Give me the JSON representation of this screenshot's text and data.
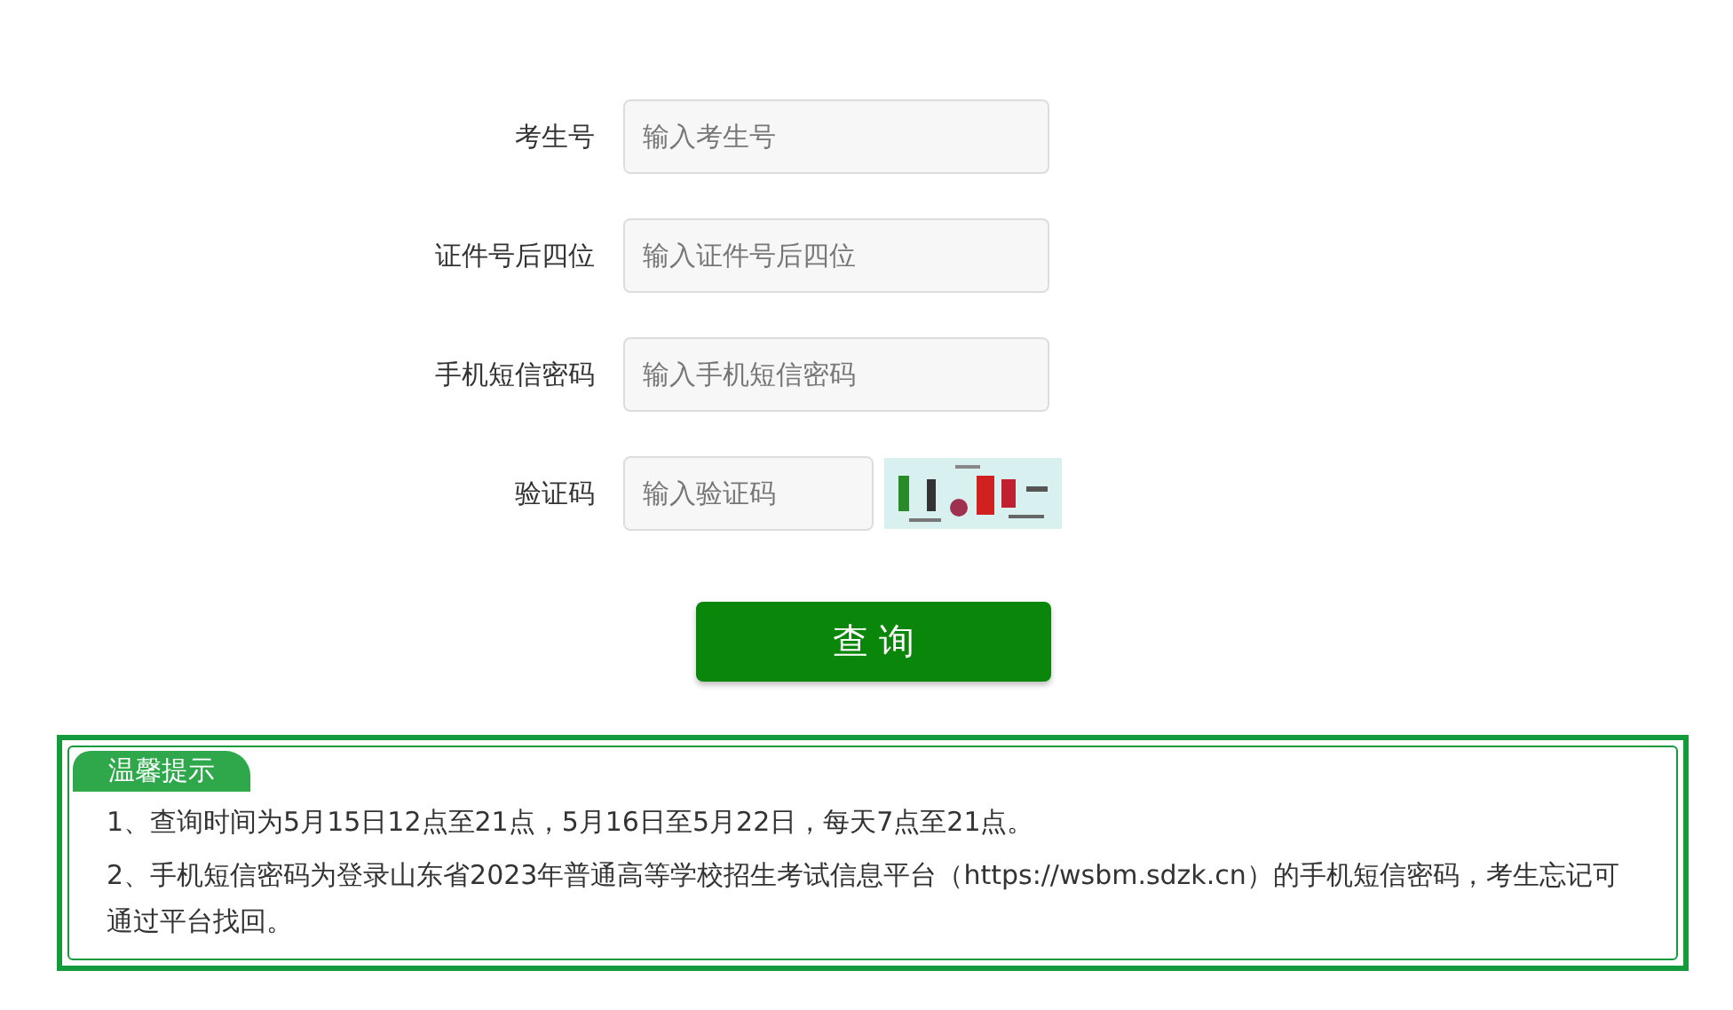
{
  "form": {
    "fields": [
      {
        "label": "考生号",
        "placeholder": "输入考生号",
        "kind": "text"
      },
      {
        "label": "证件号后四位",
        "placeholder": "输入证件号后四位",
        "kind": "text"
      },
      {
        "label": "手机短信密码",
        "placeholder": "输入手机短信密码",
        "kind": "text"
      },
      {
        "label": "验证码",
        "placeholder": "输入验证码",
        "kind": "captcha"
      }
    ],
    "submit": "查 询"
  },
  "notice": {
    "title": "温馨提示",
    "lines": [
      "1、查询时间为5月15日12点至21点，5月16日至5月22日，每天7点至21点。",
      "2、手机短信密码为登录山东省2023年普通高等学校招生考试信息平台（https://wsbm.sdzk.cn）的手机短信密码，考生忘记可通过平台找回。"
    ]
  }
}
